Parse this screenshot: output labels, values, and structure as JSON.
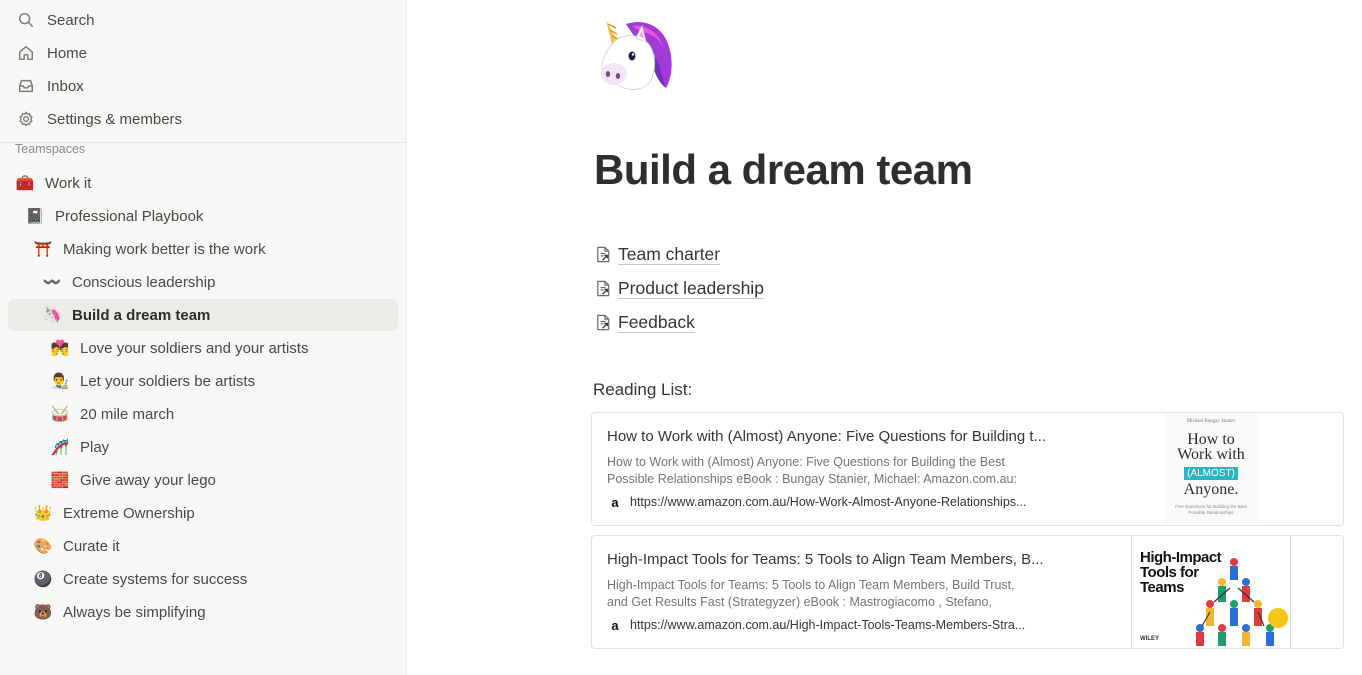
{
  "sidebar": {
    "nav": [
      {
        "label": "Search",
        "icon": "search-icon"
      },
      {
        "label": "Home",
        "icon": "home-icon"
      },
      {
        "label": "Inbox",
        "icon": "inbox-icon"
      },
      {
        "label": "Settings & members",
        "icon": "gear-icon"
      }
    ],
    "section_label": "Teamspaces",
    "tree": [
      {
        "label": "Work it",
        "emoji": "🧰"
      },
      {
        "label": "Professional Playbook",
        "emoji": "📓"
      },
      {
        "label": "Making work better is the work",
        "emoji": "⛩️"
      },
      {
        "label": "Conscious leadership",
        "emoji": "〰️"
      },
      {
        "label": "Build a dream team",
        "emoji": "🦄"
      },
      {
        "label": "Love your soldiers and your artists",
        "emoji": "💏"
      },
      {
        "label": "Let your soldiers be artists",
        "emoji": "👨‍🎨"
      },
      {
        "label": "20 mile march",
        "emoji": "🥁"
      },
      {
        "label": "Play",
        "emoji": "🎢"
      },
      {
        "label": "Give away your lego",
        "emoji": "🧱"
      },
      {
        "label": "Extreme Ownership",
        "emoji": "👑"
      },
      {
        "label": "Curate it",
        "emoji": "🎨"
      },
      {
        "label": "Create systems for success",
        "emoji": "🎱"
      },
      {
        "label": "Always be simplifying",
        "emoji": "🐻"
      }
    ]
  },
  "page": {
    "icon": "unicorn-icon",
    "title": "Build a dream team",
    "links": [
      {
        "label": "Team charter"
      },
      {
        "label": "Product leadership"
      },
      {
        "label": "Feedback"
      }
    ],
    "reading_label": "Reading List:",
    "bookmarks": [
      {
        "title": "How to Work with (Almost) Anyone: Five Questions for Building t...",
        "desc_line1": "How to Work with (Almost) Anyone: Five Questions for Building the Best",
        "desc_line2": "Possible Relationships eBook : Bungay Stanier, Michael: Amazon.com.au:",
        "favicon": "a",
        "url": "https://www.amazon.com.au/How-Work-Almost-Anyone-Relationships...",
        "thumb_author": "Michael Bungay Stanier",
        "thumb_line1": "How to",
        "thumb_line2": "Work with",
        "thumb_line3": "(ALMOST)",
        "thumb_line4": "Anyone.",
        "thumb_sub": "Five Questions for Building the Best Possible Relationships"
      },
      {
        "title": "High-Impact Tools for Teams: 5 Tools to Align Team Members, B...",
        "desc_line1": "High-Impact Tools for Teams: 5 Tools to Align Team Members, Build Trust,",
        "desc_line2": "and Get Results Fast (Strategyzer) eBook : Mastrogiacomo , Stefano,",
        "favicon": "a",
        "url": "https://www.amazon.com.au/High-Impact-Tools-Teams-Members-Stra...",
        "thumb_line1": "High-Impact",
        "thumb_line2": "Tools for",
        "thumb_line3": "Teams",
        "thumb_publisher": "WILEY"
      }
    ]
  },
  "colors": {
    "sidebar_bg": "#f7f7f5",
    "selected_bg": "#ebebe8",
    "text": "#37352f",
    "muted": "#8c8a85",
    "teal_accent": "#2cb5c0"
  }
}
